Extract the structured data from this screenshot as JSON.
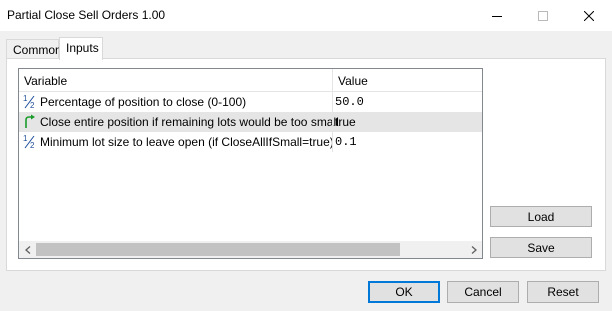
{
  "window": {
    "title": "Partial Close Sell Orders 1.00"
  },
  "tabs": [
    {
      "label": "Common"
    },
    {
      "label": "Inputs"
    }
  ],
  "grid": {
    "headers": {
      "variable": "Variable",
      "value": "Value"
    },
    "rows": [
      {
        "icon": "half-fraction-icon",
        "label": "Percentage of position to close (0-100)",
        "value": "50.0"
      },
      {
        "icon": "green-arrow-icon",
        "label": "Close entire position if remaining lots would be too small",
        "value": "true"
      },
      {
        "icon": "half-fraction-icon",
        "label": "Minimum lot size to leave open (if CloseAllIfSmall=true)",
        "value": "0.1"
      }
    ]
  },
  "side_buttons": {
    "load": "Load",
    "save": "Save"
  },
  "footer": {
    "ok": "OK",
    "cancel": "Cancel",
    "reset": "Reset"
  }
}
